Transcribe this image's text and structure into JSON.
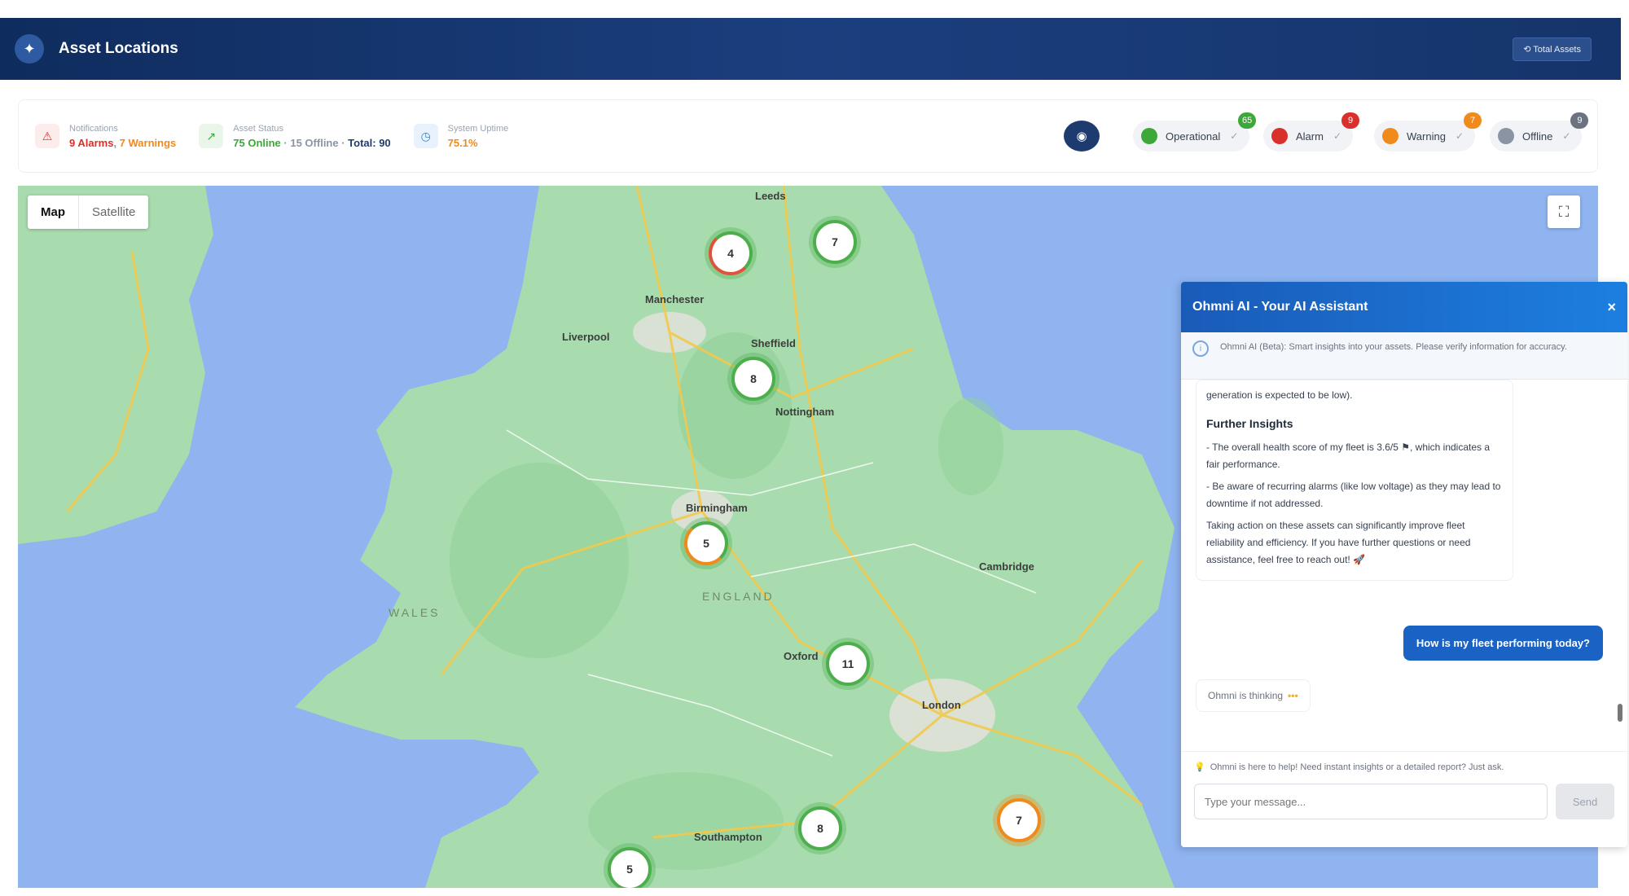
{
  "header": {
    "title": "Asset Locations",
    "button_label": "⟲ Total Assets",
    "logo_icon": "compass-icon"
  },
  "status": {
    "notifications": {
      "label": "Notifications",
      "value_alarms": "9 Alarms",
      "separator": ", ",
      "value_warnings": "7 Warnings"
    },
    "asset_status": {
      "label": "Asset Status",
      "online": "75 Online",
      "offline": "· 15 Offline ·",
      "total": "Total: 90"
    },
    "uptime": {
      "label": "System Uptime",
      "value": "75.1%"
    }
  },
  "filters": [
    {
      "label": "Operational",
      "color": "#3da83a",
      "count": "65"
    },
    {
      "label": "Alarm",
      "color": "#d9302c",
      "count": "9"
    },
    {
      "label": "Warning",
      "color": "#f08a1b",
      "count": "7"
    },
    {
      "label": "Offline",
      "color": "#8a94a3",
      "count": "9"
    }
  ],
  "map": {
    "toggle": {
      "map": "Map",
      "satellite": "Satellite"
    },
    "cities": [
      "Manchester",
      "Liverpool",
      "Sheffield",
      "Birmingham",
      "London",
      "Southampton",
      "Leeds",
      "Nottingham",
      "Oxford",
      "Cambridge"
    ],
    "regions": [
      "WALES",
      "ENGLAND"
    ],
    "clusters": [
      "4",
      "7",
      "8",
      "5",
      "11",
      "8",
      "7",
      "5"
    ]
  },
  "chat": {
    "title": "Ohmni AI - Your AI Assistant",
    "close": "×",
    "info": "Ohmni AI (Beta): Smart insights into your assets. Please verify information for accuracy.",
    "bot_top": "generation is expected to be low).",
    "bot_heading": "Further Insights",
    "bot_p1": "- The overall health score of my fleet is 3.6/5 ⚑, which indicates a fair performance.",
    "bot_p2": "- Be aware of recurring alarms (like low voltage) as they may lead to downtime if not addressed.",
    "bot_p3": "Taking action on these assets can significantly improve fleet reliability and efficiency. If you have further questions or need assistance, feel free to reach out! 🚀",
    "user_msg": "How is my fleet performing today?",
    "typing": "Ohmni is thinking",
    "typing_dots": "•••",
    "hint": "Ohmni is here to help! Need instant insights or a detailed report? Just ask.",
    "input_placeholder": "Type your message...",
    "send": "Send"
  }
}
